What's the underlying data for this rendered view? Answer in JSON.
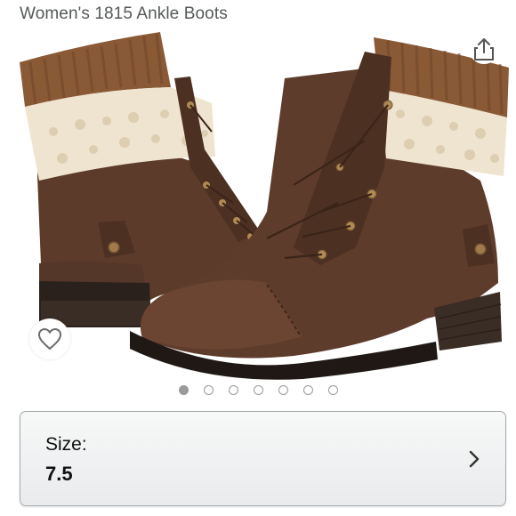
{
  "product": {
    "title": "Women's 1815 Ankle Boots"
  },
  "icons": {
    "share": "share-icon",
    "wishlist": "heart-icon",
    "chevron": "chevron-right-icon"
  },
  "carousel": {
    "count": 7,
    "active_index": 0
  },
  "size_selector": {
    "label": "Size:",
    "value": "7.5"
  },
  "colors": {
    "boot_brown": "#5a3a2a",
    "knit_brown": "#8b5e3c",
    "fleece": "#efe4cf",
    "sole": "#2b211c"
  }
}
